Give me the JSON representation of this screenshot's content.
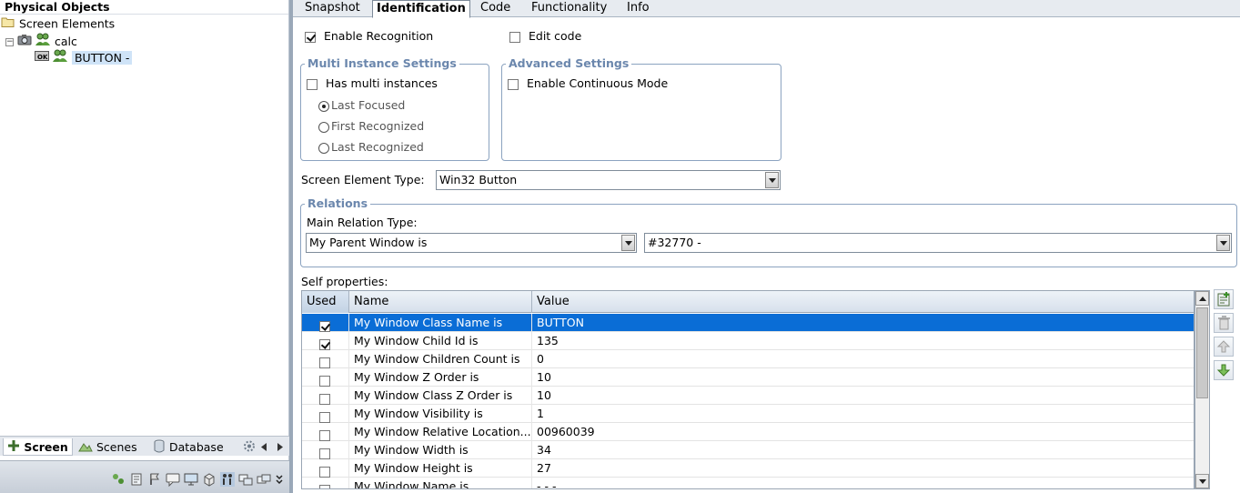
{
  "left_pane": {
    "title": "Physical Objects",
    "tree": {
      "root_label": "Screen Elements",
      "calc_label": "calc",
      "button_label": "BUTTON -",
      "collapse_symbol": "−"
    },
    "bottom_tabs": {
      "screen": "Screen",
      "scenes": "Scenes",
      "database": "Database"
    }
  },
  "tabs": {
    "snapshot": "Snapshot",
    "identification": "Identification",
    "code": "Code",
    "functionality": "Functionality",
    "info": "Info"
  },
  "identification": {
    "enable_recognition": {
      "label": "Enable Recognition",
      "checked": true
    },
    "edit_code": {
      "label": "Edit code",
      "checked": false
    },
    "multi_instance": {
      "title": "Multi Instance Settings",
      "has_multi_instances": {
        "label": "Has multi instances",
        "checked": false
      },
      "options": [
        "Last Focused",
        "First Recognized",
        "Last Recognized"
      ],
      "selected": "Last Focused"
    },
    "advanced": {
      "title": "Advanced Settings",
      "enable_continuous_mode": {
        "label": "Enable Continuous Mode",
        "checked": false
      }
    },
    "screen_element_type": {
      "label": "Screen Element Type:",
      "value": "Win32 Button"
    },
    "relations": {
      "title": "Relations",
      "main_relation_label": "Main Relation Type:",
      "relation_value": "My Parent Window is",
      "target_value": "#32770 -"
    },
    "self_properties": {
      "label": "Self properties:",
      "columns": [
        "Used",
        "Name",
        "Value"
      ],
      "rows": [
        {
          "used": true,
          "name": "My Window Class Name is",
          "value": "BUTTON"
        },
        {
          "used": true,
          "name": "My Window Child Id is",
          "value": "135"
        },
        {
          "used": false,
          "name": "My Window Children Count is",
          "value": "0"
        },
        {
          "used": false,
          "name": "My Window Z Order is",
          "value": "10"
        },
        {
          "used": false,
          "name": "My Window Class Z Order is",
          "value": "10"
        },
        {
          "used": false,
          "name": "My Window Visibility is",
          "value": "1"
        },
        {
          "used": false,
          "name": "My Window Relative Location...",
          "value": "00960039"
        },
        {
          "used": false,
          "name": "My Window Width is",
          "value": "34"
        },
        {
          "used": false,
          "name": "My Window Height is",
          "value": "27"
        },
        {
          "used": false,
          "name": "My Window Name is",
          "value": "- - -"
        }
      ],
      "selected_row": 0
    }
  },
  "colors": {
    "selection": "#0a6dd6",
    "group_title": "#6b87ad",
    "tree_selection": "#cfe3f7"
  }
}
